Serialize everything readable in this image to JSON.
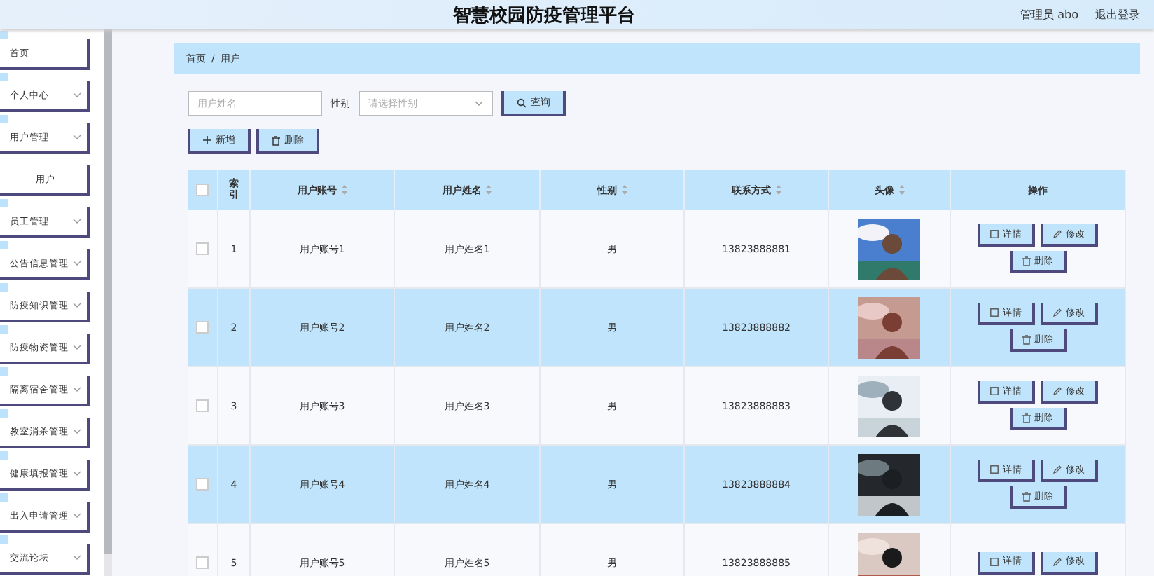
{
  "header": {
    "title": "智慧校园防疫管理平台",
    "user": "管理员 abo",
    "logout": "退出登录"
  },
  "sidebar": {
    "items": [
      {
        "label": "首页",
        "kind": "link"
      },
      {
        "label": "个人中心",
        "kind": "menu"
      },
      {
        "label": "用户管理",
        "kind": "menu"
      },
      {
        "label": "用户",
        "kind": "sub"
      },
      {
        "label": "员工管理",
        "kind": "menu"
      },
      {
        "label": "公告信息管理",
        "kind": "menu"
      },
      {
        "label": "防疫知识管理",
        "kind": "menu"
      },
      {
        "label": "防疫物资管理",
        "kind": "menu"
      },
      {
        "label": "隔离宿舍管理",
        "kind": "menu"
      },
      {
        "label": "教室消杀管理",
        "kind": "menu"
      },
      {
        "label": "健康填报管理",
        "kind": "menu"
      },
      {
        "label": "出入申请管理",
        "kind": "menu"
      },
      {
        "label": "交流论坛",
        "kind": "menu"
      }
    ]
  },
  "breadcrumb": {
    "home": "首页",
    "separator": "/",
    "current": "用户"
  },
  "search": {
    "name_placeholder": "用户姓名",
    "gender_label": "性别",
    "gender_placeholder": "请选择性别",
    "query_button": "查询"
  },
  "actions": {
    "add": "新增",
    "delete": "删除"
  },
  "table": {
    "select_all_checked": false,
    "columns": [
      {
        "label": "索引",
        "sortable": false
      },
      {
        "label": "用户账号",
        "sortable": true
      },
      {
        "label": "用户姓名",
        "sortable": true
      },
      {
        "label": "性别",
        "sortable": true
      },
      {
        "label": "联系方式",
        "sortable": true
      },
      {
        "label": "头像",
        "sortable": true
      },
      {
        "label": "操作",
        "sortable": false
      }
    ],
    "rows": [
      {
        "index": "1",
        "account": "用户账号1",
        "name": "用户姓名1",
        "gender": "男",
        "phone": "13823888881",
        "checked": false,
        "avatar": {
          "kind": "picture"
        },
        "buttons": [
          {
            "kind": "detail",
            "label": "详情"
          },
          {
            "kind": "edit",
            "label": "修改"
          },
          {
            "kind": "delete",
            "label": "删除"
          }
        ]
      },
      {
        "index": "2",
        "account": "用户账号2",
        "name": "用户姓名2",
        "gender": "男",
        "phone": "13823888882",
        "checked": false,
        "avatar": {
          "kind": "picture"
        },
        "buttons": [
          {
            "kind": "detail",
            "label": "详情"
          },
          {
            "kind": "edit",
            "label": "修改"
          },
          {
            "kind": "delete",
            "label": "删除"
          }
        ]
      },
      {
        "index": "3",
        "account": "用户账号3",
        "name": "用户姓名3",
        "gender": "男",
        "phone": "13823888883",
        "checked": false,
        "avatar": {
          "kind": "picture"
        },
        "buttons": [
          {
            "kind": "detail",
            "label": "详情"
          },
          {
            "kind": "edit",
            "label": "修改"
          },
          {
            "kind": "delete",
            "label": "删除"
          }
        ]
      },
      {
        "index": "4",
        "account": "用户账号4",
        "name": "用户姓名4",
        "gender": "男",
        "phone": "13823888884",
        "checked": false,
        "avatar": {
          "kind": "picture"
        },
        "buttons": [
          {
            "kind": "detail",
            "label": "详情"
          },
          {
            "kind": "edit",
            "label": "修改"
          },
          {
            "kind": "delete",
            "label": "删除"
          }
        ]
      },
      {
        "index": "5",
        "account": "用户账号5",
        "name": "用户姓名5",
        "gender": "男",
        "phone": "13823888885",
        "checked": false,
        "avatar": {
          "kind": "picture"
        },
        "buttons": [
          {
            "kind": "detail",
            "label": "详情"
          },
          {
            "kind": "edit",
            "label": "修改"
          }
        ]
      }
    ]
  }
}
